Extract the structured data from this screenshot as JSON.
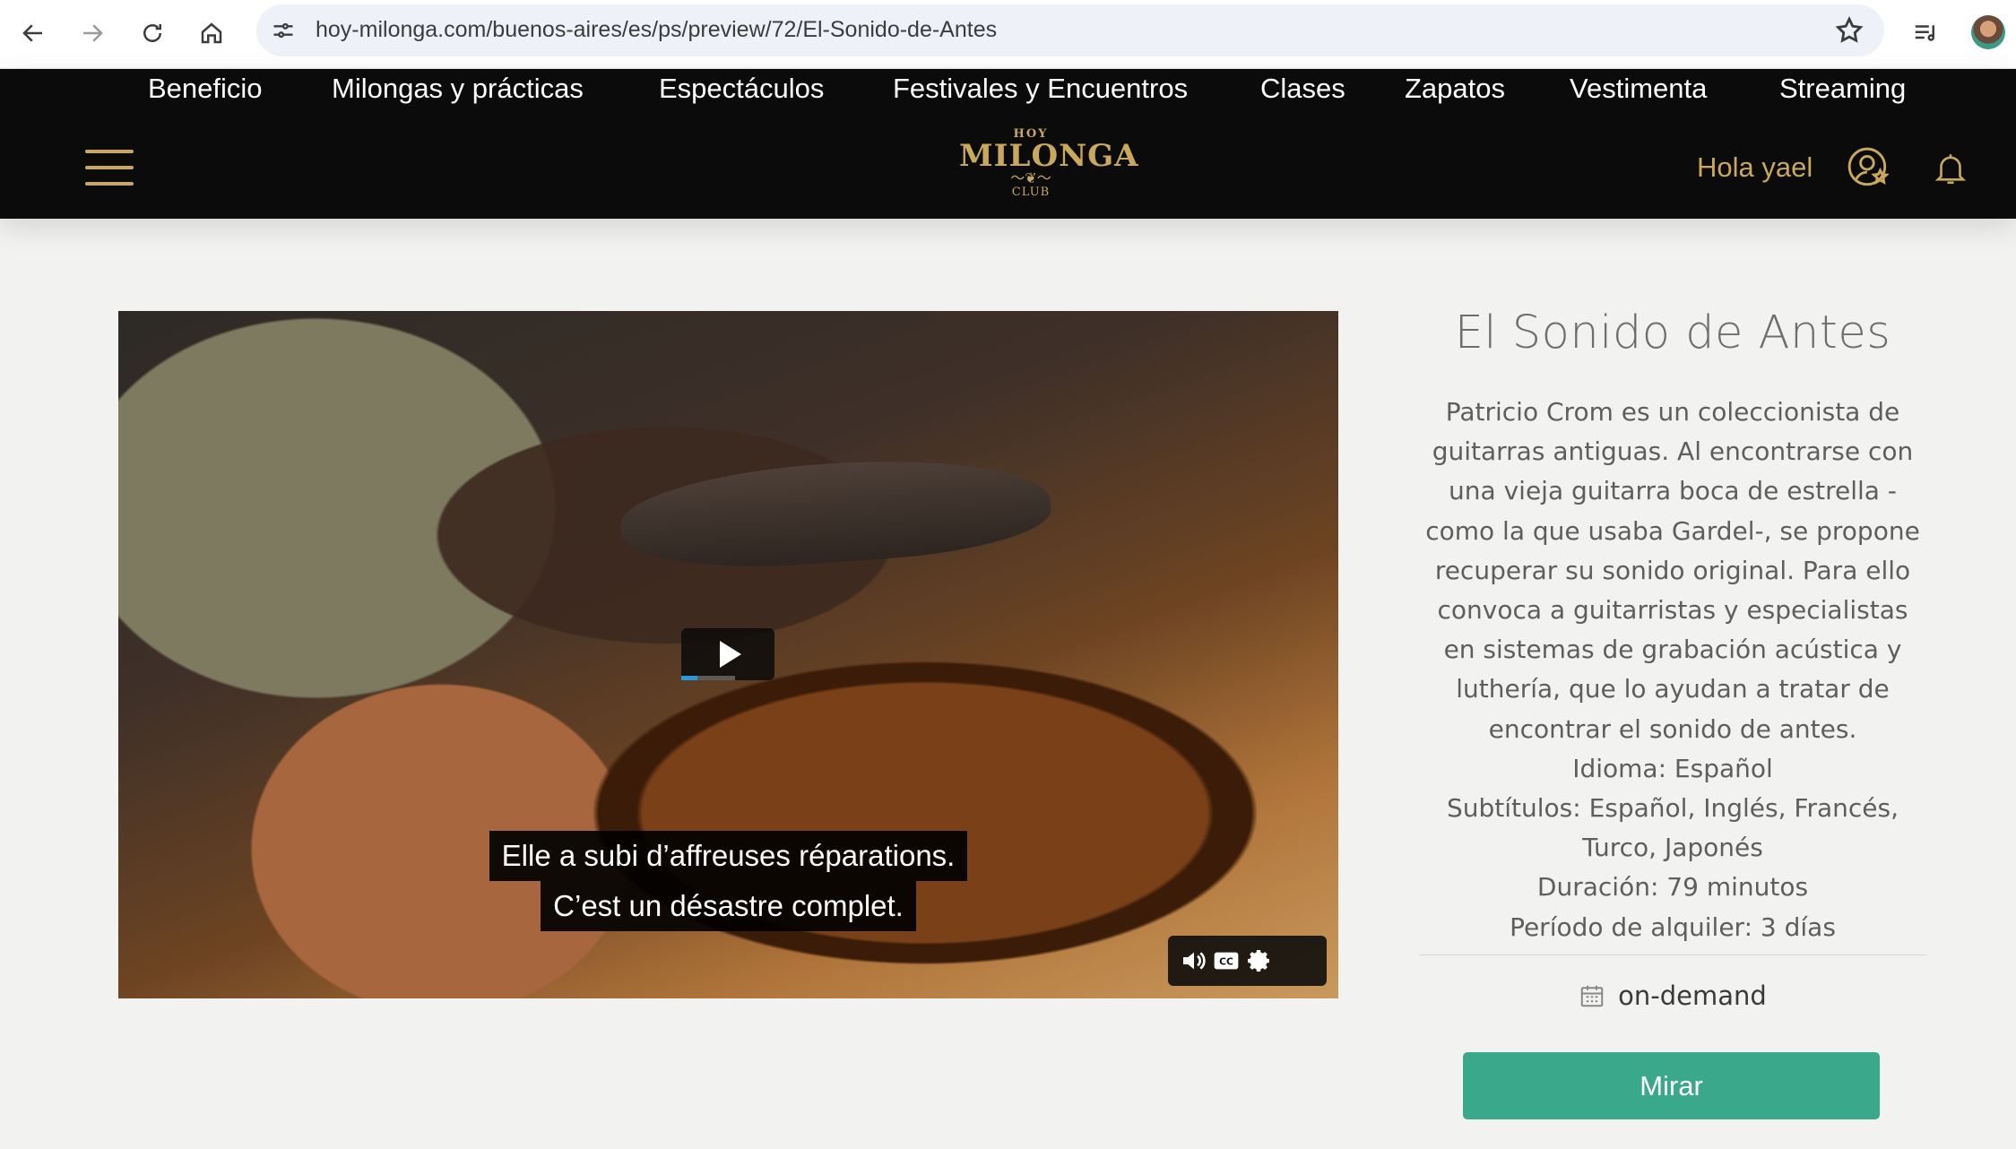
{
  "browser": {
    "url": "hoy-milonga.com/buenos-aires/es/ps/preview/72/El-Sonido-de-Antes"
  },
  "header": {
    "nav": [
      "Beneficio",
      "Milongas y prácticas",
      "Espectáculos",
      "Festivales y Encuentros",
      "Clases",
      "Zapatos",
      "Vestimenta",
      "Streaming"
    ],
    "logo": {
      "top": "HOY",
      "main": "MILONGA",
      "bottom": "CLUB"
    },
    "greeting": "Hola yael",
    "accent_color": "#c9a85c"
  },
  "video": {
    "subtitle_line1": "Elle a subi d’affreuses réparations.",
    "subtitle_line2": "C’est un désastre complet.",
    "progress": 0.3,
    "controls": [
      "volume-icon",
      "closed-captions-icon",
      "settings-gear-icon"
    ]
  },
  "movie": {
    "title": "El Sonido de Antes",
    "description": "Patricio Crom es un coleccionista de guitarras antiguas. Al encontrarse con una vieja guitarra boca de estrella -como la que usaba Gardel-, se propone recuperar su sonido original. Para ello convoca a guitarristas y especialistas en sistemas de grabación acústica y luthería, que lo ayudan a tratar de encontrar el sonido de antes.",
    "language": "Idioma: Español",
    "subtitles": "Subtítulos: Español, Inglés, Francés, Turco, Japonés",
    "duration": "Duración: 79 minutos",
    "rental_period": "Período de alquiler: 3 días",
    "availability": "on-demand",
    "watch_label": "Mirar",
    "button_color": "#3aa88a"
  }
}
